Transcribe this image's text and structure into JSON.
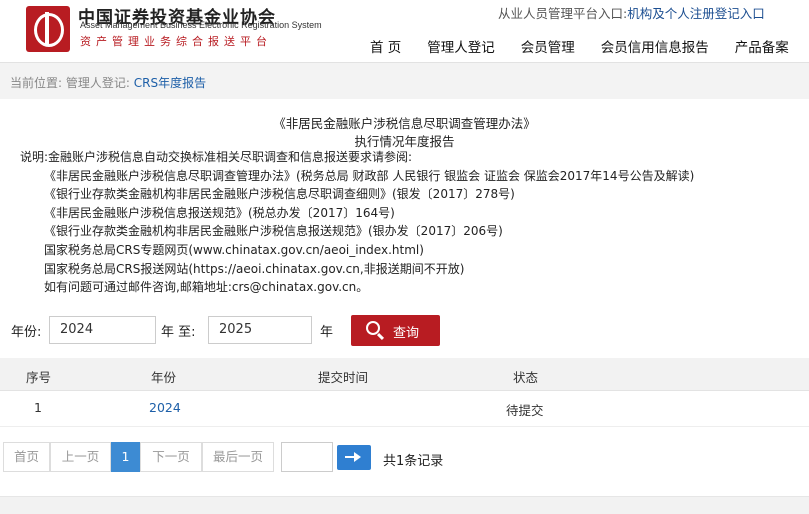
{
  "header": {
    "org_cn": "中国证券投资基金业协会",
    "org_en": "Asset Management Business Electronic Registration System",
    "org_sub": "资产管理业务综合报送平台",
    "portal_prefix": "从业人员管理平台入口:",
    "portal_link": "机构及个人注册登记入口",
    "nav": [
      "首 页",
      "管理人登记",
      "会员管理",
      "会员信用信息报告",
      "产品备案"
    ]
  },
  "breadcrumb": {
    "prefix": "当前位置:",
    "parent": "管理人登记:",
    "current": "CRS年度报告"
  },
  "doc": {
    "title_line1": "《非居民金融账户涉税信息尽职调查管理办法》",
    "title_line2": "执行情况年度报告",
    "notes": [
      "说明:金融账户涉税信息自动交换标准相关尽职调查和信息报送要求请参阅:",
      "《非居民金融账户涉税信息尽职调查管理办法》(税务总局 财政部 人民银行 银监会 证监会 保监会2017年14号公告及解读)",
      "《银行业存款类金融机构非居民金融账户涉税信息尽职调查细则》(银发〔2017〕278号)",
      "《非居民金融账户涉税信息报送规范》(税总办发〔2017〕164号)",
      "《银行业存款类金融机构非居民金融账户涉税信息报送规范》(银办发〔2017〕206号)",
      "国家税务总局CRS专题网页(www.chinatax.gov.cn/aeoi_index.html)",
      "国家税务总局CRS报送网站(https://aeoi.chinatax.gov.cn,非报送期间不开放)",
      "如有问题可通过邮件咨询,邮箱地址:crs@chinatax.gov.cn。"
    ]
  },
  "filter": {
    "year_label": "年份:",
    "from_value": "2024",
    "to_label": "年 至:",
    "to_value": "2025",
    "end_label": "年",
    "query_label": "查询"
  },
  "table": {
    "headers": [
      "序号",
      "年份",
      "提交时间",
      "状态"
    ],
    "rows": [
      {
        "index": "1",
        "year": "2024",
        "submit_time": "",
        "status": "待提交"
      }
    ]
  },
  "pagination": {
    "first": "首页",
    "prev": "上一页",
    "current": "1",
    "next": "下一页",
    "last": "最后一页",
    "total": "共1条记录"
  },
  "colors": {
    "brand_red": "#b81c22",
    "link_blue": "#1d5fa8",
    "active_page": "#3d8bd3"
  }
}
